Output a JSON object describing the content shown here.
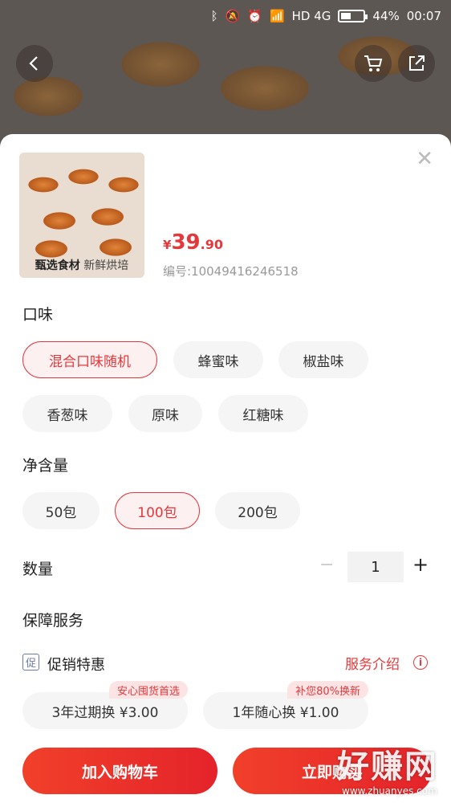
{
  "status_bar": {
    "network": "HD 4G",
    "battery": "44%",
    "time": "00:07"
  },
  "top_buttons": {
    "back_icon": "back-arrow-icon",
    "cart_icon": "cart-icon",
    "share_icon": "share-icon"
  },
  "product": {
    "caption_bold": "甄选食材",
    "caption_rest": "新鲜烘培",
    "price_currency": "¥",
    "price_integer": "39",
    "price_decimal": ".90",
    "sku": "编号:10049416246518"
  },
  "flavor": {
    "title": "口味",
    "options": [
      "混合口味随机",
      "蜂蜜味",
      "椒盐味",
      "香葱味",
      "原味",
      "红糖味"
    ],
    "selected": "混合口味随机"
  },
  "net_content": {
    "title": "净含量",
    "options": [
      "50包",
      "100包",
      "200包"
    ],
    "selected": "100包"
  },
  "quantity": {
    "title": "数量",
    "value": "1",
    "minus": "−",
    "plus": "+"
  },
  "guarantee": {
    "title": "保障服务",
    "promo_icon_text": "促",
    "promo_label": "促销特惠",
    "service_intro": "服务介绍",
    "info_icon_text": "i",
    "services": [
      {
        "label": "3年过期换 ¥3.00",
        "tag": "安心囤货首选"
      },
      {
        "label": "1年随心换 ¥1.00",
        "tag": "补您80%换新"
      }
    ]
  },
  "actions": {
    "add_to_cart": "加入购物车",
    "buy_now": "立即购买"
  },
  "watermark": {
    "text": "好赚网",
    "url": "www.zhuanyes.com"
  },
  "colors": {
    "accent": "#e4393c",
    "selected_bg": "#fdf0f0",
    "chip_bg": "#f5f5f5"
  }
}
